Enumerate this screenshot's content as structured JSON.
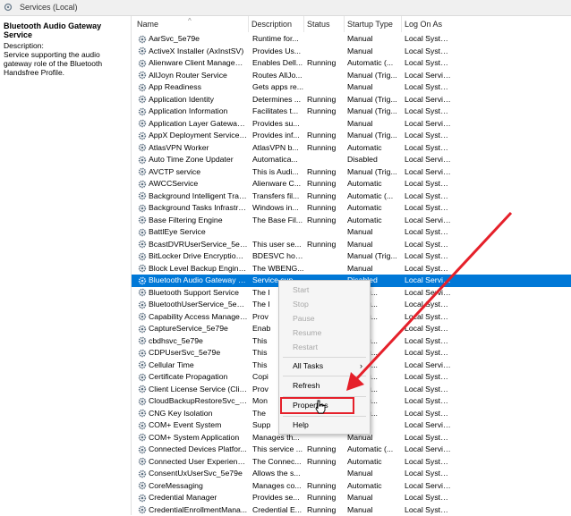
{
  "window": {
    "title": "Services (Local)"
  },
  "left_pane": {
    "service_name": "Bluetooth Audio Gateway Service",
    "description_label": "Description:",
    "description_text": "Service supporting the audio gateway role of the Bluetooth Handsfree Profile."
  },
  "columns": {
    "name": "Name",
    "description": "Description",
    "status": "Status",
    "startup": "Startup Type",
    "logon": "Log On As"
  },
  "services": [
    {
      "name": "AarSvc_5e79e",
      "desc": "Runtime for...",
      "status": "",
      "startup": "Manual",
      "logon": "Local Syste..."
    },
    {
      "name": "ActiveX Installer (AxInstSV)",
      "desc": "Provides Us...",
      "status": "",
      "startup": "Manual",
      "logon": "Local Syste..."
    },
    {
      "name": "Alienware Client Manageme...",
      "desc": "Enables Dell...",
      "status": "Running",
      "startup": "Automatic (...",
      "logon": "Local Syste..."
    },
    {
      "name": "AllJoyn Router Service",
      "desc": "Routes AllJo...",
      "status": "",
      "startup": "Manual (Trig...",
      "logon": "Local Service"
    },
    {
      "name": "App Readiness",
      "desc": "Gets apps re...",
      "status": "",
      "startup": "Manual",
      "logon": "Local Syste..."
    },
    {
      "name": "Application Identity",
      "desc": "Determines ...",
      "status": "Running",
      "startup": "Manual (Trig...",
      "logon": "Local Service"
    },
    {
      "name": "Application Information",
      "desc": "Facilitates t...",
      "status": "Running",
      "startup": "Manual (Trig...",
      "logon": "Local Syste..."
    },
    {
      "name": "Application Layer Gateway ...",
      "desc": "Provides su...",
      "status": "",
      "startup": "Manual",
      "logon": "Local Service"
    },
    {
      "name": "AppX Deployment Service (...",
      "desc": "Provides inf...",
      "status": "Running",
      "startup": "Manual (Trig...",
      "logon": "Local Syste..."
    },
    {
      "name": "AtlasVPN Worker",
      "desc": "AtlasVPN b...",
      "status": "Running",
      "startup": "Automatic",
      "logon": "Local Syste..."
    },
    {
      "name": "Auto Time Zone Updater",
      "desc": "Automatica...",
      "status": "",
      "startup": "Disabled",
      "logon": "Local Service"
    },
    {
      "name": "AVCTP service",
      "desc": "This is Audi...",
      "status": "Running",
      "startup": "Manual (Trig...",
      "logon": "Local Service"
    },
    {
      "name": "AWCCService",
      "desc": "Alienware C...",
      "status": "Running",
      "startup": "Automatic",
      "logon": "Local Syste..."
    },
    {
      "name": "Background Intelligent Tran...",
      "desc": "Transfers fil...",
      "status": "Running",
      "startup": "Automatic (...",
      "logon": "Local Syste..."
    },
    {
      "name": "Background Tasks Infrastruc...",
      "desc": "Windows in...",
      "status": "Running",
      "startup": "Automatic",
      "logon": "Local Syste..."
    },
    {
      "name": "Base Filtering Engine",
      "desc": "The Base Fil...",
      "status": "Running",
      "startup": "Automatic",
      "logon": "Local Service"
    },
    {
      "name": "BattlEye Service",
      "desc": "",
      "status": "",
      "startup": "Manual",
      "logon": "Local Syste..."
    },
    {
      "name": "BcastDVRUserService_5e79e",
      "desc": "This user se...",
      "status": "Running",
      "startup": "Manual",
      "logon": "Local Syste..."
    },
    {
      "name": "BitLocker Drive Encryption ...",
      "desc": "BDESVC hos...",
      "status": "",
      "startup": "Manual (Trig...",
      "logon": "Local Syste..."
    },
    {
      "name": "Block Level Backup Engine ...",
      "desc": "The WBENG...",
      "status": "",
      "startup": "Manual",
      "logon": "Local Syste..."
    },
    {
      "name": "Bluetooth Audio Gateway S...",
      "desc": "Service sup...",
      "status": "",
      "startup": "Disabled",
      "logon": "Local Service"
    },
    {
      "name": "Bluetooth Support Service",
      "desc": "The I",
      "status": "",
      "startup": "al (Trig...",
      "logon": "Local Service"
    },
    {
      "name": "BluetoothUserService_5e79e",
      "desc": "The I",
      "status": "",
      "startup": "al (Trig...",
      "logon": "Local Syste..."
    },
    {
      "name": "Capability Access Manager ...",
      "desc": "Prov",
      "status": "",
      "startup": "al (Trig...",
      "logon": "Local Syste..."
    },
    {
      "name": "CaptureService_5e79e",
      "desc": "Enab",
      "status": "",
      "startup": "al",
      "logon": "Local Syste..."
    },
    {
      "name": "cbdhsvc_5e79e",
      "desc": "This",
      "status": "",
      "startup": "al (Trig...",
      "logon": "Local Syste..."
    },
    {
      "name": "CDPUserSvc_5e79e",
      "desc": "This",
      "status": "",
      "startup": "al (Trig...",
      "logon": "Local Syste..."
    },
    {
      "name": "Cellular Time",
      "desc": "This",
      "status": "",
      "startup": "al (Trig...",
      "logon": "Local Service"
    },
    {
      "name": "Certificate Propagation",
      "desc": "Copi",
      "status": "",
      "startup": "al (Trig...",
      "logon": "Local Syste..."
    },
    {
      "name": "Client License Service (ClipS...",
      "desc": "Prov",
      "status": "",
      "startup": "al (Trig...",
      "logon": "Local Syste..."
    },
    {
      "name": "CloudBackupRestoreSvc_5e...",
      "desc": "Mon",
      "status": "",
      "startup": "al (Trig...",
      "logon": "Local Syste..."
    },
    {
      "name": "CNG Key Isolation",
      "desc": "The",
      "status": "",
      "startup": "al (Trig...",
      "logon": "Local Syste..."
    },
    {
      "name": "COM+ Event System",
      "desc": "Supp",
      "status": "",
      "startup": "matic",
      "logon": "Local Service"
    },
    {
      "name": "COM+ System Application",
      "desc": "Manages th...",
      "status": "",
      "startup": "Manual",
      "logon": "Local Syste..."
    },
    {
      "name": "Connected Devices Platfor...",
      "desc": "This service ...",
      "status": "Running",
      "startup": "Automatic (...",
      "logon": "Local Service"
    },
    {
      "name": "Connected User Experience...",
      "desc": "The Connec...",
      "status": "Running",
      "startup": "Automatic",
      "logon": "Local Syste..."
    },
    {
      "name": "ConsentUxUserSvc_5e79e",
      "desc": "Allows the s...",
      "status": "",
      "startup": "Manual",
      "logon": "Local Syste..."
    },
    {
      "name": "CoreMessaging",
      "desc": "Manages co...",
      "status": "Running",
      "startup": "Automatic",
      "logon": "Local Service"
    },
    {
      "name": "Credential Manager",
      "desc": "Provides se...",
      "status": "Running",
      "startup": "Manual",
      "logon": "Local Syste..."
    },
    {
      "name": "CredentialEnrollmentMana...",
      "desc": "Credential E...",
      "status": "Running",
      "startup": "Manual",
      "logon": "Local Syste..."
    }
  ],
  "selected_index": 20,
  "context_menu": {
    "start": "Start",
    "stop": "Stop",
    "pause": "Pause",
    "resume": "Resume",
    "restart": "Restart",
    "all_tasks": "All Tasks",
    "refresh": "Refresh",
    "properties": "Properties",
    "help": "Help"
  },
  "colors": {
    "selection": "#0078d7",
    "highlight_box": "#e5202a",
    "arrow": "#e5202a"
  },
  "icons": {
    "service": "gear-icon",
    "submenu": "chevron-right-icon",
    "cursor": "hand-pointer-icon"
  }
}
